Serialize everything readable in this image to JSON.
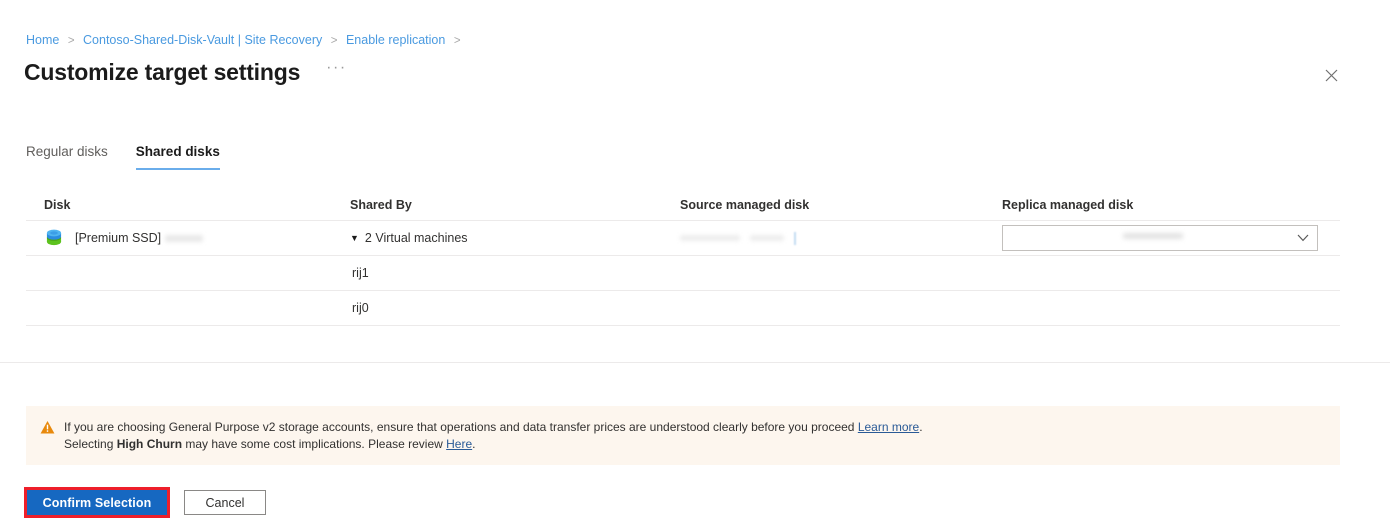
{
  "breadcrumb": {
    "items": [
      {
        "label": "Home"
      },
      {
        "label": "Contoso-Shared-Disk-Vault | Site Recovery"
      },
      {
        "label": "Enable replication"
      }
    ],
    "separator": ">"
  },
  "header": {
    "title": "Customize target settings",
    "ellipsis": "···",
    "close_icon": "close-icon"
  },
  "tabs": [
    {
      "label": "Regular disks",
      "active": false
    },
    {
      "label": "Shared disks",
      "active": true
    }
  ],
  "table": {
    "columns": [
      {
        "label": "Disk"
      },
      {
        "label": "Shared By"
      },
      {
        "label": "Source managed disk"
      },
      {
        "label": "Replica managed disk"
      }
    ],
    "rows": [
      {
        "disk_icon": "managed-disk-icon",
        "disk": "[Premium SSD]",
        "expander": "▼",
        "shared_by": "2 Virtual machines",
        "source_managed_disk": "",
        "replica_managed_disk": "",
        "replica_chevron": "⌄"
      },
      {
        "disk": "",
        "shared_by": "rij1"
      },
      {
        "disk": "",
        "shared_by": "rij0"
      }
    ]
  },
  "warning": {
    "icon": "warning-triangle-icon",
    "line1_before": "If you are choosing General Purpose v2 storage accounts, ensure that operations and data transfer prices are understood clearly before you proceed ",
    "line1_link": "Learn more",
    "line1_after": ".",
    "line2_before": "Selecting ",
    "line2_bold": "High Churn",
    "line2_mid": " may have some cost implications. Please review ",
    "line2_link": "Here",
    "line2_after": "."
  },
  "footer": {
    "confirm_label": "Confirm Selection",
    "cancel_label": "Cancel"
  },
  "colors": {
    "accent_blue": "#1668c1",
    "link_blue": "#4a9ae0",
    "tab_underline": "#6aadeb",
    "warning_bg": "#fdf6ee",
    "warning_icon": "#e8890c",
    "highlight_red": "#ee1f2a"
  }
}
